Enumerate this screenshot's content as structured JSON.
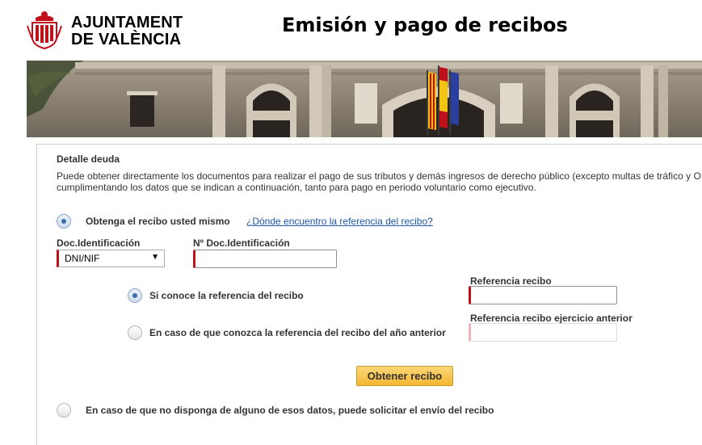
{
  "header": {
    "org_line1": "AJUNTAMENT",
    "org_line2": "DE VALÈNCIA",
    "title": "Emisión y pago de recibos"
  },
  "detail": {
    "section_title": "Detalle deuda",
    "intro_line1": "Puede obtener directamente los documentos para realizar el pago de sus tributos y demás ingresos de derecho público (excepto multas de tráfico y O",
    "intro_line2": "cumplimentando los datos que se indican a continuación, tanto para pago en periodo voluntario como ejecutivo."
  },
  "option_self": {
    "label": "Obtenga el recibo usted mismo",
    "checked": true,
    "help_link": "¿Dónde encuentro la referencia del recibo?"
  },
  "doc_type": {
    "label": "Doc.Identificación",
    "selected": "DNI/NIF"
  },
  "doc_number": {
    "label": "Nº Doc.Identificación",
    "value": ""
  },
  "sub_option_known": {
    "label": "Si conoce la referencia del recibo",
    "checked": true
  },
  "sub_option_previous": {
    "label": "En caso de que conozca la referencia del recibo del año anterior",
    "checked": false
  },
  "ref_receipt": {
    "label": "Referencia recibo",
    "value": ""
  },
  "ref_receipt_previous": {
    "label": "Referencia recibo ejercicio anterior",
    "value": ""
  },
  "submit": {
    "label": "Obtener recibo"
  },
  "option_request": {
    "label": "En caso de que no disponga de alguno de esos datos, puede solicitar el envío del recibo",
    "checked": false
  },
  "colors": {
    "accent_required": "#c0101a",
    "link": "#1f56a8",
    "button": "#f3b630"
  }
}
